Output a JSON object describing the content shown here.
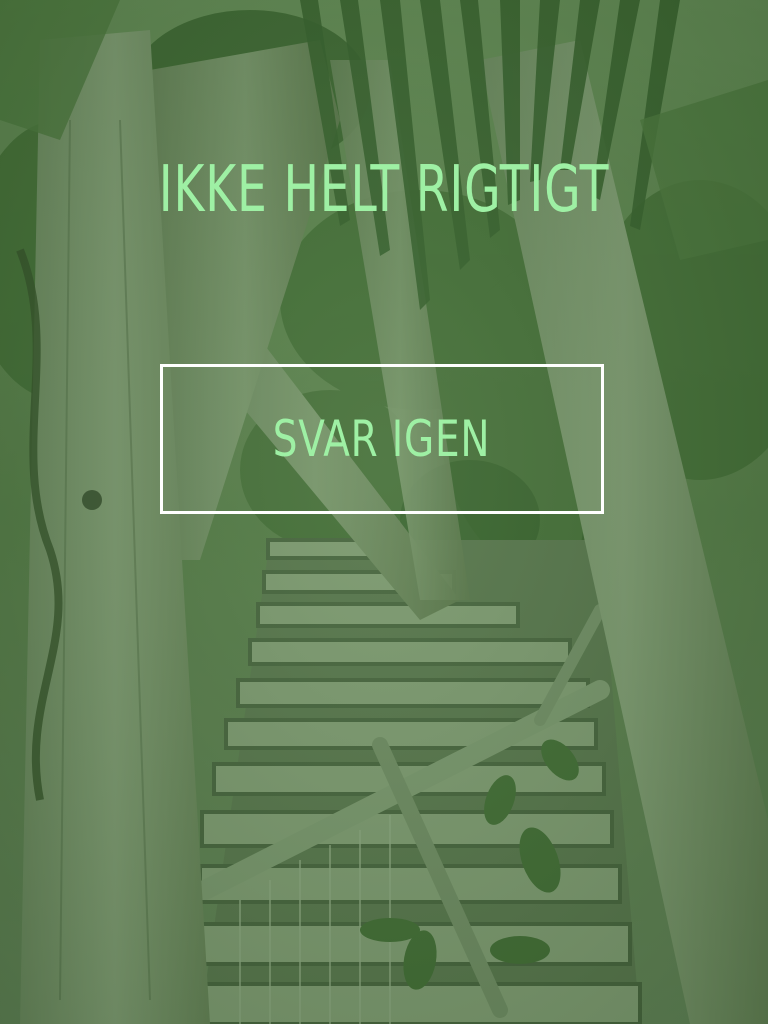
{
  "result": {
    "title": "IKKE HELT RIGTIGT"
  },
  "actions": {
    "retry_label": "SVAR IGEN"
  },
  "colors": {
    "text_accent": "#9ef0a4",
    "button_border": "#ffffff",
    "overlay_tint": "#5b8a4f"
  }
}
